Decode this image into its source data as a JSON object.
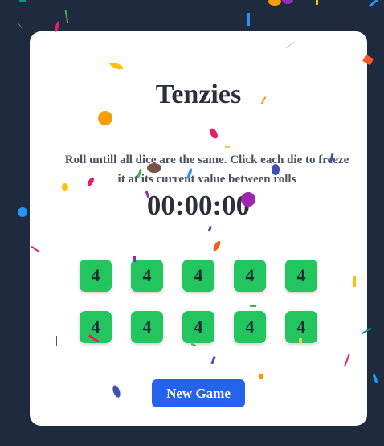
{
  "app": {
    "title": "Tenzies",
    "instructions": "Roll untill all dice are the same. Click each die to freeze it at its current value between rolls"
  },
  "timer": {
    "display": "00:00:00"
  },
  "dice": {
    "values": [
      "4",
      "4",
      "4",
      "4",
      "4",
      "4",
      "4",
      "4",
      "4",
      "4"
    ],
    "held_color": "#22c55e"
  },
  "controls": {
    "new_game_label": "New Game",
    "button_color": "#2563eb"
  },
  "colors": {
    "background": "#1e2a3e",
    "card": "#ffffff",
    "confetti": [
      "#f59e0b",
      "#9c27b0",
      "#e91e63",
      "#3f51b5",
      "#2196f3",
      "#ff5722",
      "#4caf50",
      "#795548",
      "#ffc107",
      "#cddc39",
      "#009688",
      "#673ab7"
    ]
  }
}
